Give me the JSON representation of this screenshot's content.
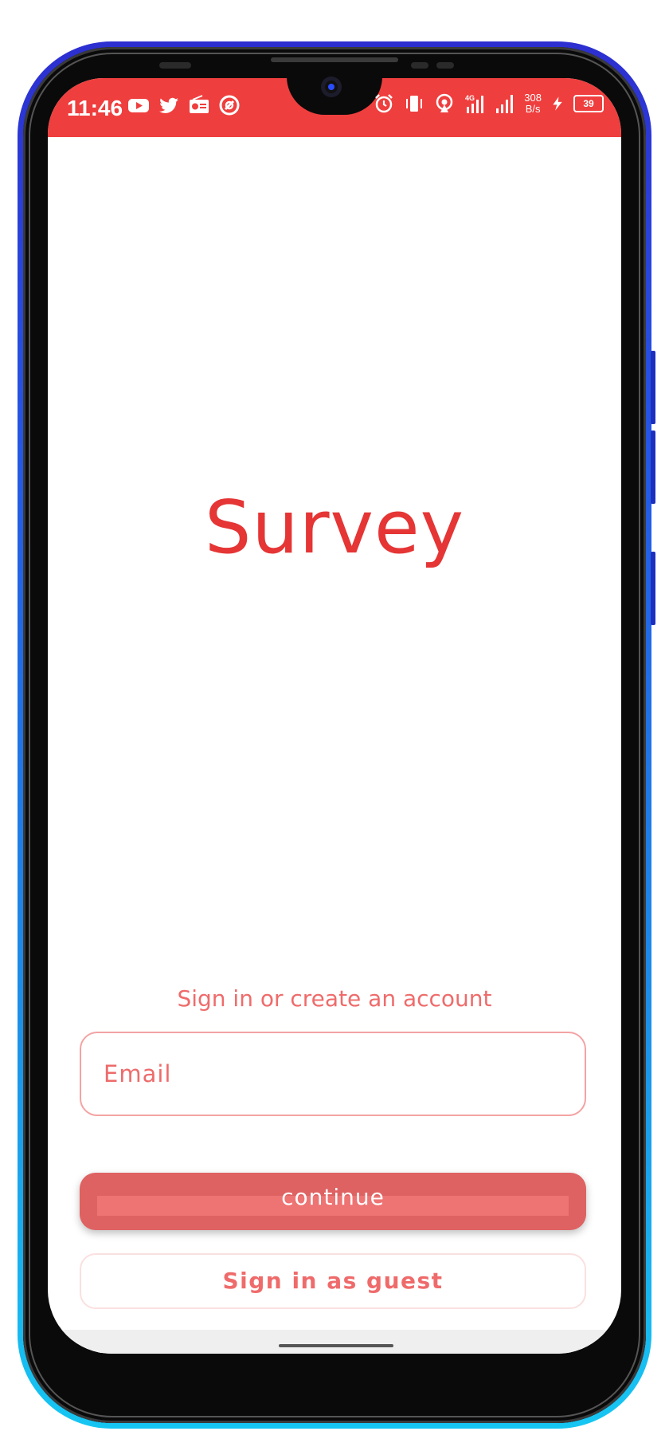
{
  "status_bar": {
    "time": "11:46",
    "net_speed_value": "308",
    "net_speed_unit": "B/s",
    "network_type": "4G",
    "battery": "39",
    "left_icons": [
      "youtube-icon",
      "twitter-icon",
      "radio-icon",
      "app-icon"
    ],
    "right_icons": [
      "alarm-icon",
      "vibrate-icon",
      "hotspot-icon",
      "signal-4g-icon",
      "signal-icon",
      "charging-icon"
    ]
  },
  "app": {
    "title": "Survey",
    "subtitle": "Sign in or create an account",
    "email_placeholder": "Email",
    "continue_label": "continue",
    "guest_label": "Sign in as guest"
  },
  "colors": {
    "accent": "#ef3e3e",
    "title": "#e53535",
    "button": "#df6262",
    "text_light": "#ef6b6b",
    "frame_top": "#2d2fd0",
    "frame_bottom": "#16c6f2"
  }
}
